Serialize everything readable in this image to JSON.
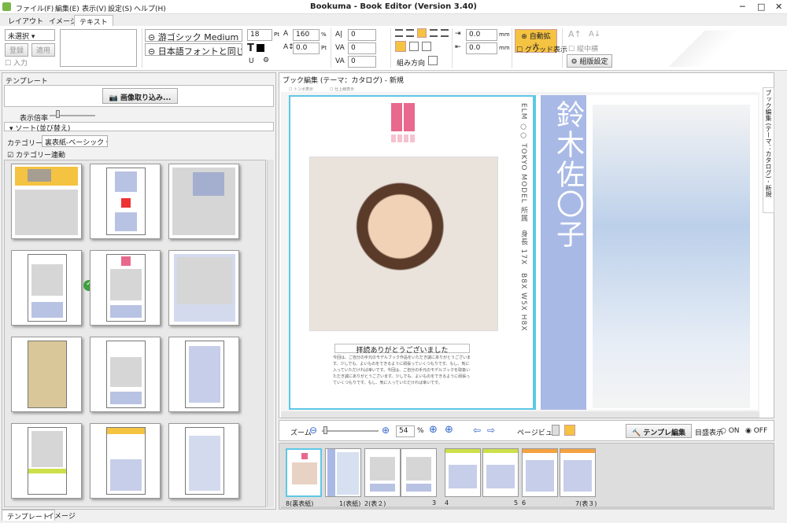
{
  "app": {
    "title": "Bookuma - Book Editor (Version 3.40)",
    "window_controls": {
      "minimize": "─",
      "maximize": "□",
      "close": "✕"
    }
  },
  "menu": [
    "ファイル(F)",
    "編集(E)",
    "表示(V)",
    "設定(S)",
    "ヘルプ(H)"
  ],
  "tabs": [
    "レイアウト",
    "イメージ",
    "テキスト"
  ],
  "ribbon": {
    "selection": "未選択",
    "register": "登録",
    "apply": "適用",
    "input": "入力",
    "font": "游ゴシック Medium",
    "jfont": "日本語フォントと同じ",
    "size": "18",
    "size_unit": "Pt",
    "scale": "160",
    "scale_unit": "%",
    "spacing": "0.0",
    "spacing_unit": "Pt",
    "val_a": "0",
    "val_b": "0",
    "val_c": "0",
    "direction": "組み方向",
    "mm1": "0.0",
    "mm2": "0.0",
    "mm_unit": "mm",
    "auto_zoom": "自動拡大",
    "grid": "グリッド表示",
    "gaiji": "縦中横",
    "detail": "組版設定"
  },
  "left": {
    "header": "テンプレート",
    "import_button": "画像取り込み...",
    "zoom_label": "表示倍率",
    "sort": "ソート(並び替え)",
    "category_label": "カテゴリー",
    "category_value": "裏表紙-ベーシック",
    "category_link": "カテゴリー連動",
    "bottom_tabs": [
      "テンプレート",
      "イメージ"
    ]
  },
  "editor": {
    "header": "ブック編集 (テーマ：カタログ) - 新規",
    "side_tab": "ブック編集 (テーマ：カタログ) - 新規",
    "check1": "トンボ表示",
    "check2": "仕上線表示",
    "greeting": "拝読ありがとうございました",
    "body": "今回は、ご自分の手元のモデルブック作品をいただき誠にありがとうございます。少しでも、よいものをできるように頑張っていくつもりです。もし、気に入っていただければ幸いです。今回は、ご自分の手元のモデルブックを取扱いただき誠にありがとうございます。少しでも、よいものをできるように頑張っていくつもりです。もし、気に入っていただければ幸いです。",
    "vertical_info": "ELM ○○ TOKYO MODEL 所属　身長 17X　B8X W5X H8X",
    "name": "鈴木佐〇子"
  },
  "toolbar": {
    "zoom": "ズーム",
    "zoom_value": "54",
    "zoom_unit": "%",
    "page_view": "ページビュー",
    "template_edit": "テンプレ編集",
    "flag": "目盛表示",
    "on": "ON",
    "off": "OFF"
  },
  "pages": [
    {
      "label": "8(裏表紙)"
    },
    {
      "label": "1(表紙)"
    },
    {
      "label": "2(表２)"
    },
    {
      "label": "3"
    },
    {
      "label": "4"
    },
    {
      "label": "5"
    },
    {
      "label": "6"
    },
    {
      "label": "7(表３)"
    }
  ],
  "colors": {
    "accent": "#f5c342",
    "pink": "#e8698d",
    "blue": "#a9b9e6",
    "frame": "#5ec7e6"
  }
}
